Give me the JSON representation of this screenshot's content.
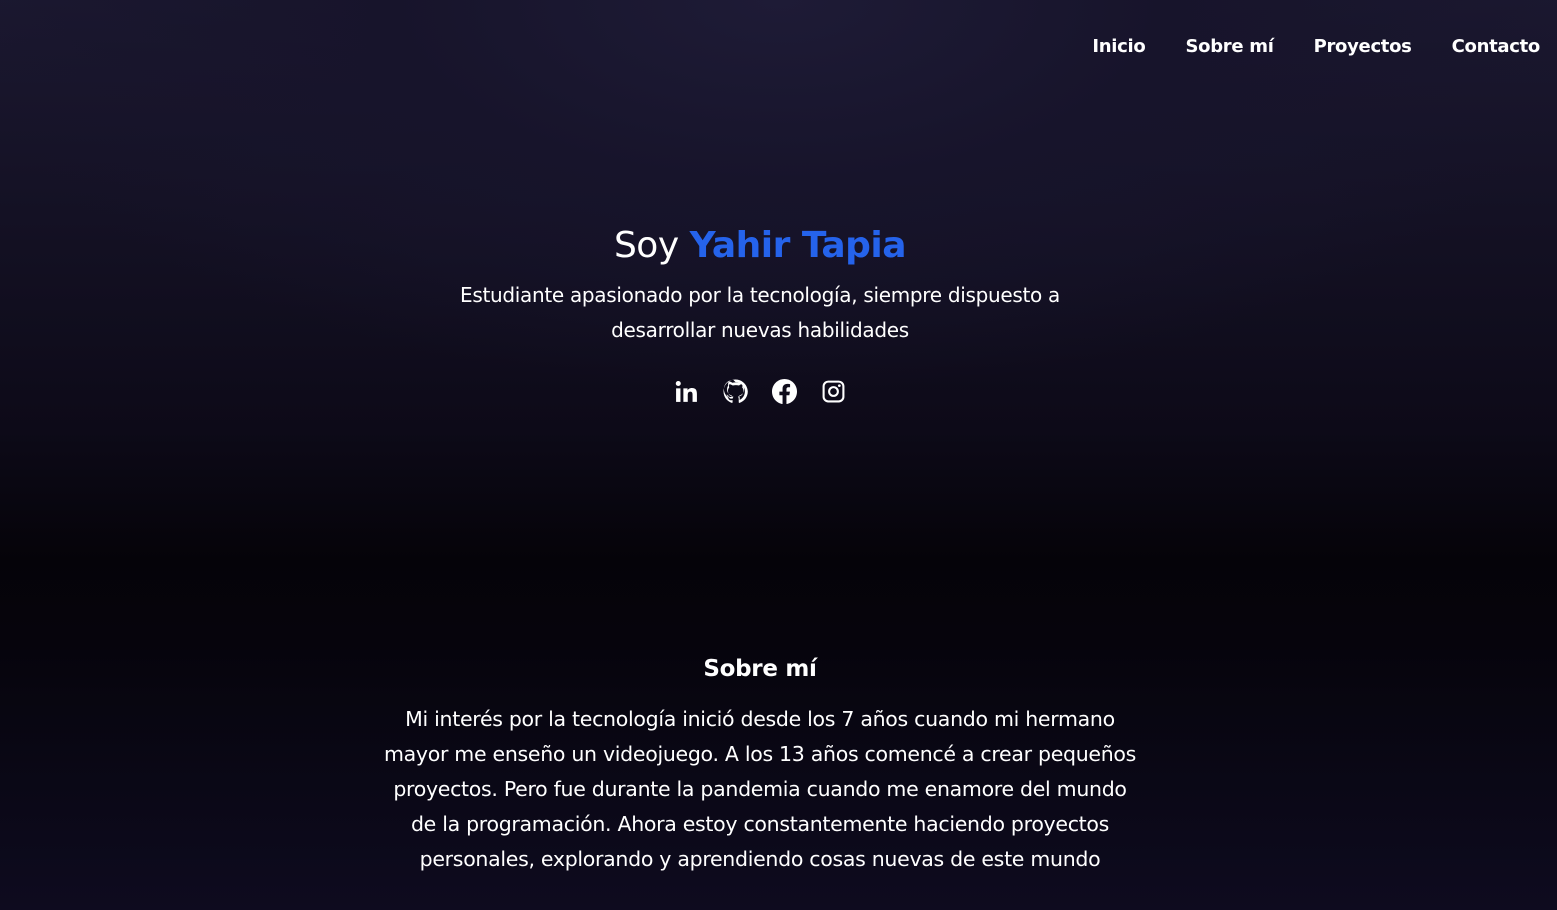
{
  "nav": {
    "items": [
      {
        "label": "Inicio"
      },
      {
        "label": "Sobre mí"
      },
      {
        "label": "Proyectos"
      },
      {
        "label": "Contacto"
      }
    ]
  },
  "hero": {
    "prefix": "Soy",
    "name": "Yahir Tapia",
    "subtitle": "Estudiante apasionado por la tecnología, siempre dispuesto a desarrollar nuevas habilidades",
    "accent_color": "#2563eb",
    "socials": [
      {
        "icon": "linkedin-icon"
      },
      {
        "icon": "github-icon"
      },
      {
        "icon": "facebook-icon"
      },
      {
        "icon": "instagram-icon"
      }
    ]
  },
  "about": {
    "title": "Sobre mí",
    "text": "Mi interés por la tecnología inició desde los 7 años cuando mi hermano mayor me enseño un videojuego. A los 13 años comencé a crear pequeños proyectos. Pero fue durante la pandemia cuando me enamore del mundo de la programación. Ahora estoy constantemente haciendo proyectos personales, explorando y aprendiendo cosas nuevas de este mundo"
  }
}
